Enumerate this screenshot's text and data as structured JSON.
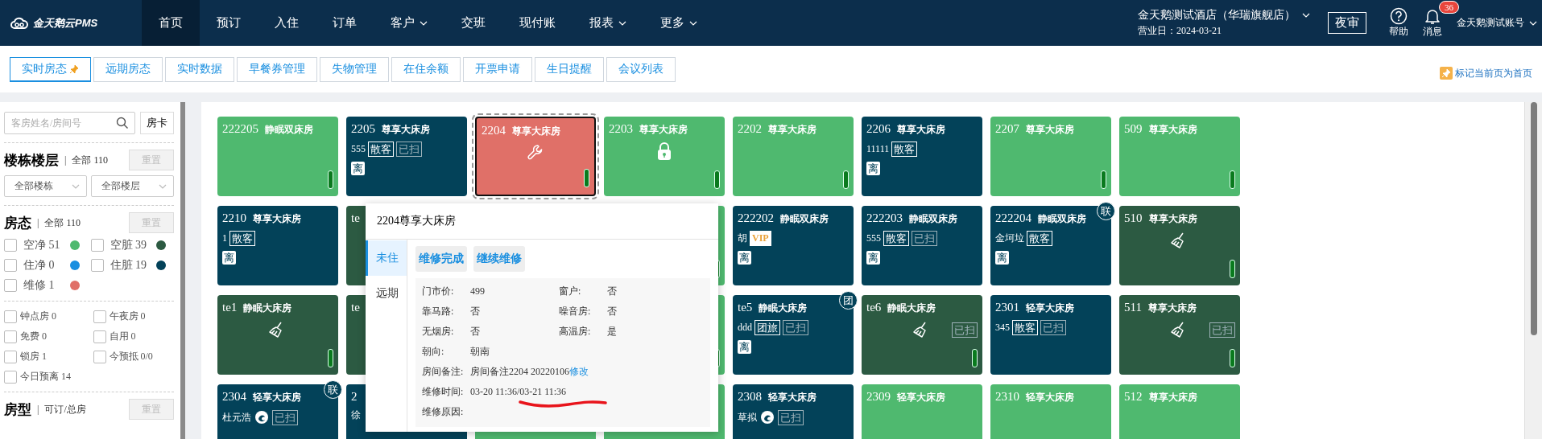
{
  "topbar": {
    "logo": "金天鹅云PMS",
    "nav": [
      {
        "label": "首页",
        "selected": true,
        "caret": false
      },
      {
        "label": "预订",
        "selected": false,
        "caret": false
      },
      {
        "label": "入住",
        "selected": false,
        "caret": false
      },
      {
        "label": "订单",
        "selected": false,
        "caret": false
      },
      {
        "label": "客户",
        "selected": false,
        "caret": true
      },
      {
        "label": "交班",
        "selected": false,
        "caret": false
      },
      {
        "label": "现付账",
        "selected": false,
        "caret": false
      },
      {
        "label": "报表",
        "selected": false,
        "caret": true
      },
      {
        "label": "更多",
        "selected": false,
        "caret": true
      }
    ],
    "hotel": "金天鹅测试酒店（华瑞旗舰店）",
    "business_day": "营业日：2024-03-21",
    "night_audit": "夜审",
    "help": "帮助",
    "messages": "消息",
    "message_count": "36",
    "account": "金天鹅测试账号"
  },
  "page_tabs": [
    {
      "label": "实时房态",
      "selected": true,
      "pinned": true
    },
    {
      "label": "远期房态",
      "selected": false,
      "pinned": false
    },
    {
      "label": "实时数据",
      "selected": false,
      "pinned": false
    },
    {
      "label": "早餐券管理",
      "selected": false,
      "pinned": false
    },
    {
      "label": "失物管理",
      "selected": false,
      "pinned": false
    },
    {
      "label": "在住余额",
      "selected": false,
      "pinned": false
    },
    {
      "label": "开票申请",
      "selected": false,
      "pinned": false
    },
    {
      "label": "生日提醒",
      "selected": false,
      "pinned": false
    },
    {
      "label": "会议列表",
      "selected": false,
      "pinned": false
    }
  ],
  "mark_home": "标记当前页为首页",
  "sidebar": {
    "search": {
      "placeholder": "客房姓名/房间号"
    },
    "room_card_button": "房卡",
    "building": {
      "title": "楼栋楼层",
      "divider": "|",
      "count": "全部 110",
      "reset": "重置",
      "selects": [
        "全部楼栋",
        "全部楼层"
      ]
    },
    "status": {
      "title": "房态",
      "divider": "|",
      "count": "全部 110",
      "reset": "重置",
      "filters": [
        {
          "label": "空净 51",
          "checked": false,
          "color": "#4fb96f"
        },
        {
          "label": "空脏 39",
          "checked": false,
          "color": "#2c5a42"
        },
        {
          "label": "住净 0",
          "checked": false,
          "color": "#1a8fe0"
        },
        {
          "label": "住脏 19",
          "checked": false,
          "color": "#034259"
        },
        {
          "label": "维修 1",
          "checked": false,
          "color": "#e07068"
        }
      ]
    },
    "options": [
      {
        "label": "钟点房 0",
        "checked": false
      },
      {
        "label": "午夜房 0",
        "checked": false
      },
      {
        "label": "免费 0",
        "checked": false
      },
      {
        "label": "自用 0",
        "checked": false
      },
      {
        "label": "锁房 1",
        "checked": false
      },
      {
        "label": "今预抵 0/0",
        "checked": false
      },
      {
        "label": "今日预离 14",
        "checked": false
      }
    ],
    "room_type": {
      "title": "房型",
      "divider": "|",
      "count": "可订/总房",
      "reset": "重置"
    }
  },
  "room_rows": [
    {
      "rooms": [
        {
          "number": "222205",
          "type": "静眠双床房",
          "color": "#4fb96f",
          "bar": true
        },
        {
          "number": "2205",
          "type": "尊享大床房",
          "color": "#034259",
          "guest": "555",
          "tags": [
            {
              "text": "散客",
              "kind": "source"
            },
            {
              "text": "已扫",
              "kind": "cleaned"
            }
          ],
          "leave": "离"
        },
        {
          "number": "2204",
          "type": "尊享大床房",
          "color": "#e07068",
          "under_repair": true,
          "bar": true,
          "selected": true
        },
        {
          "number": "2203",
          "type": "尊享大床房",
          "color": "#4fb96f",
          "locked": true,
          "bar": true
        },
        {
          "number": "2202",
          "type": "尊享大床房",
          "color": "#4fb96f",
          "bar": true
        },
        {
          "number": "2206",
          "type": "尊享大床房",
          "color": "#034259",
          "guest": "11111",
          "tags": [
            {
              "text": "散客",
              "kind": "source"
            }
          ],
          "leave": "离"
        },
        {
          "number": "2207",
          "type": "尊享大床房",
          "color": "#4fb96f",
          "bar": true
        },
        {
          "number": "509",
          "type": "尊享大床房",
          "color": "#4fb96f",
          "bar": true
        }
      ]
    },
    {
      "rooms": [
        {
          "number": "2210",
          "type": "尊享大床房",
          "color": "#034259",
          "guest": "1",
          "tags": [
            {
              "text": "散客",
              "kind": "source"
            }
          ],
          "leave": "离"
        },
        {
          "number": "te",
          "color": "#2c5a42"
        },
        {
          "color": "#4fb96f",
          "bar": true
        },
        {
          "number": "222202",
          "type": "静眠双床房",
          "color": "#034259",
          "guest": "胡",
          "tags": [
            {
              "text": "VIP",
              "kind": "vip"
            }
          ],
          "leave": "离"
        },
        {
          "number": "222203",
          "type": "静眠双床房",
          "color": "#034259",
          "guest": "555",
          "tags": [
            {
              "text": "散客",
              "kind": "source"
            },
            {
              "text": "已扫",
              "kind": "cleaned"
            }
          ],
          "leave": "离"
        },
        {
          "number": "222204",
          "type": "静眠双床房",
          "color": "#034259",
          "guest": "金坷垃",
          "tags": [
            {
              "text": "散客",
              "kind": "source"
            }
          ],
          "leave": "离",
          "corner": "联"
        },
        {
          "number": "510",
          "type": "尊享大床房",
          "color": "#2c5a42",
          "needs_cleaning": true,
          "bar": true
        }
      ]
    },
    {
      "rooms": [
        {
          "number": "te1",
          "type": "静眠大床房",
          "color": "#2c5a42",
          "needs_cleaning": true,
          "bar": true
        },
        {
          "number": "te",
          "color": "#2c5a42"
        },
        {
          "color": "#4fb96f",
          "bar": true
        },
        {
          "number": "te5",
          "type": "静眠大床房",
          "color": "#034259",
          "guest": "ddd",
          "tags": [
            {
              "text": "团旅",
              "kind": "source"
            },
            {
              "text": "已扫",
              "kind": "cleaned"
            }
          ],
          "leave": "离",
          "corner": "团"
        },
        {
          "number": "te6",
          "type": "静眠大床房",
          "color": "#2c5a42",
          "needs_cleaning": true,
          "tags": [
            {
              "text": "已扫",
              "kind": "cleaned"
            }
          ],
          "bar": true
        },
        {
          "number": "2301",
          "type": "轻享大床房",
          "color": "#034259",
          "guest": "345",
          "tags": [
            {
              "text": "散客",
              "kind": "source"
            },
            {
              "text": "已扫",
              "kind": "cleaned"
            }
          ]
        },
        {
          "number": "511",
          "type": "尊享大床房",
          "color": "#2c5a42",
          "needs_cleaning": true,
          "tags": [
            {
              "text": "已扫",
              "kind": "cleaned"
            }
          ],
          "bar": true
        }
      ]
    },
    {
      "rooms": [
        {
          "number": "2304",
          "type": "轻享大床房",
          "color": "#034259",
          "guest": "杜元浩",
          "guest_icon": true,
          "tags": [
            {
              "text": "已扫",
              "kind": "cleaned"
            }
          ],
          "corner": "联"
        },
        {
          "number": "2",
          "color": "#034259",
          "guest": "徐"
        },
        {
          "color": "#4fb96f"
        },
        {
          "color": "#4fb96f"
        },
        {
          "number": "2308",
          "type": "轻享大床房",
          "color": "#034259",
          "guest": "草拟",
          "guest_icon": true,
          "tags": [
            {
              "text": "已扫",
              "kind": "cleaned"
            }
          ]
        },
        {
          "number": "2309",
          "type": "轻享大床房",
          "color": "#4fb96f"
        },
        {
          "number": "2310",
          "type": "轻享大床房",
          "color": "#4fb96f"
        },
        {
          "number": "512",
          "type": "尊享大床房",
          "color": "#4fb96f"
        }
      ]
    }
  ],
  "popup": {
    "title": "2204尊享大床房",
    "tabs": [
      {
        "label": "未住",
        "selected": true
      },
      {
        "label": "远期",
        "selected": false
      }
    ],
    "actions": [
      "维修完成",
      "继续维修"
    ],
    "details": [
      {
        "label": "门市价:",
        "value": "499",
        "wide": false
      },
      {
        "label": "窗户:",
        "value": "否",
        "wide": false
      },
      {
        "label": "靠马路:",
        "value": "否",
        "wide": false
      },
      {
        "label": "噪音房:",
        "value": "否",
        "wide": false
      },
      {
        "label": "无烟房:",
        "value": "否",
        "wide": false
      },
      {
        "label": "高温房:",
        "value": "是",
        "wide": false
      },
      {
        "label": "朝向:",
        "value": "朝南",
        "wide": true
      },
      {
        "label": "房间备注:",
        "value": "房间备注2204 20220106",
        "link": "修改",
        "wide": true
      },
      {
        "label": "维修时间:",
        "value": "03-20 11:36/03-21 11:36",
        "wide": true,
        "underlined": true
      },
      {
        "label": "维修原因:",
        "wide": true
      }
    ]
  }
}
